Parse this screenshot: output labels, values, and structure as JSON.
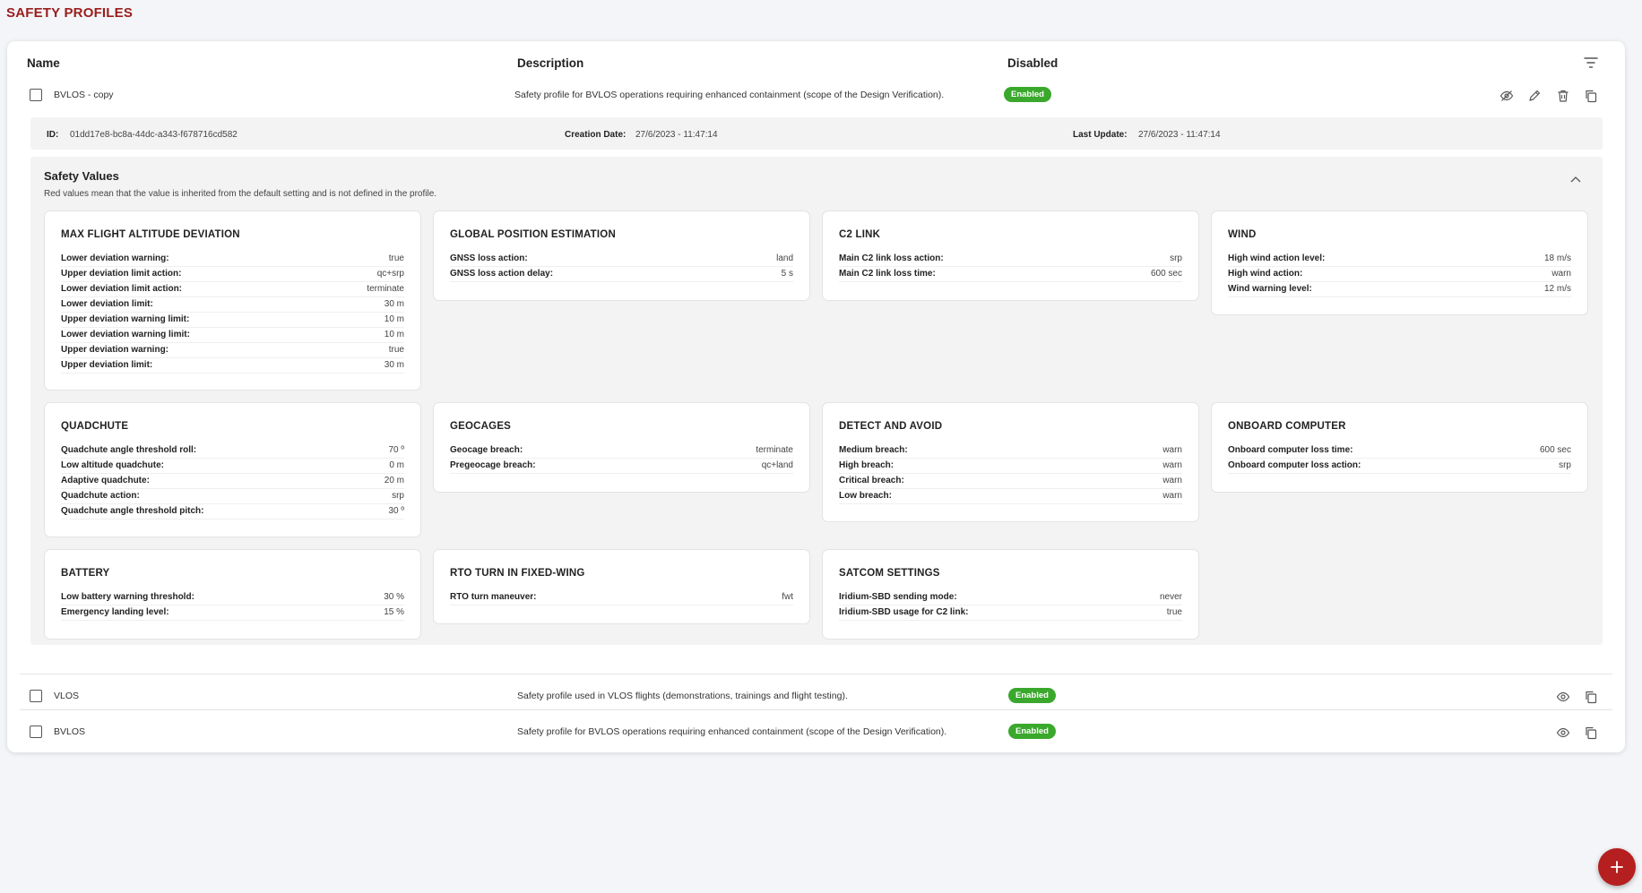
{
  "page": {
    "title": "SAFETY PROFILES"
  },
  "table": {
    "headers": {
      "name": "Name",
      "description": "Description",
      "disabled": "Disabled"
    },
    "rows": [
      {
        "name": "BVLOS - copy",
        "description": "Safety profile for BVLOS operations requiring enhanced containment (scope of the Design Verification).",
        "status": "Enabled"
      },
      {
        "name": "VLOS",
        "description": "Safety profile used in VLOS flights (demonstrations, trainings and flight testing).",
        "status": "Enabled"
      },
      {
        "name": "BVLOS",
        "description": "Safety profile for BVLOS operations requiring enhanced containment (scope of the Design Verification).",
        "status": "Enabled"
      }
    ]
  },
  "details": {
    "id_label": "ID:",
    "id_value": "01dd17e8-bc8a-44dc-a343-f678716cd582",
    "creation_label": "Creation Date:",
    "creation_value": "27/6/2023 - 11:47:14",
    "update_label": "Last Update:",
    "update_value": "27/6/2023 - 11:47:14"
  },
  "safety_values": {
    "title": "Safety Values",
    "subtitle": "Red values mean that the value is inherited from the default setting and is not defined in the profile.",
    "cards": [
      {
        "title": "MAX FLIGHT ALTITUDE DEVIATION",
        "items": [
          {
            "k": "Lower deviation warning:",
            "v": "true"
          },
          {
            "k": "Upper deviation limit action:",
            "v": "qc+srp"
          },
          {
            "k": "Lower deviation limit action:",
            "v": "terminate"
          },
          {
            "k": "Lower deviation limit:",
            "v": "30 m"
          },
          {
            "k": "Upper deviation warning limit:",
            "v": "10 m"
          },
          {
            "k": "Lower deviation warning limit:",
            "v": "10 m"
          },
          {
            "k": "Upper deviation warning:",
            "v": "true"
          },
          {
            "k": "Upper deviation limit:",
            "v": "30 m"
          }
        ]
      },
      {
        "title": "GLOBAL POSITION ESTIMATION",
        "items": [
          {
            "k": "GNSS loss action:",
            "v": "land"
          },
          {
            "k": "GNSS loss action delay:",
            "v": "5 s"
          }
        ]
      },
      {
        "title": "C2 LINK",
        "items": [
          {
            "k": "Main C2 link loss action:",
            "v": "srp"
          },
          {
            "k": "Main C2 link loss time:",
            "v": "600 sec"
          }
        ]
      },
      {
        "title": "WIND",
        "items": [
          {
            "k": "High wind action level:",
            "v": "18 m/s"
          },
          {
            "k": "High wind action:",
            "v": "warn"
          },
          {
            "k": "Wind warning level:",
            "v": "12 m/s"
          }
        ]
      },
      {
        "title": "QUADCHUTE",
        "items": [
          {
            "k": "Quadchute angle threshold roll:",
            "v": "70 º"
          },
          {
            "k": "Low altitude quadchute:",
            "v": "0 m"
          },
          {
            "k": "Adaptive quadchute:",
            "v": "20 m"
          },
          {
            "k": "Quadchute action:",
            "v": "srp"
          },
          {
            "k": "Quadchute angle threshold pitch:",
            "v": "30 º"
          }
        ]
      },
      {
        "title": "GEOCAGES",
        "items": [
          {
            "k": "Geocage breach:",
            "v": "terminate"
          },
          {
            "k": "Pregeocage breach:",
            "v": "qc+land"
          }
        ]
      },
      {
        "title": "DETECT AND AVOID",
        "items": [
          {
            "k": "Medium breach:",
            "v": "warn"
          },
          {
            "k": "High breach:",
            "v": "warn"
          },
          {
            "k": "Critical breach:",
            "v": "warn"
          },
          {
            "k": "Low breach:",
            "v": "warn"
          }
        ]
      },
      {
        "title": "ONBOARD COMPUTER",
        "items": [
          {
            "k": "Onboard computer loss time:",
            "v": "600 sec"
          },
          {
            "k": "Onboard computer loss action:",
            "v": "srp"
          }
        ]
      },
      {
        "title": "BATTERY",
        "items": [
          {
            "k": "Low battery warning threshold:",
            "v": "30 %"
          },
          {
            "k": "Emergency landing level:",
            "v": "15 %"
          }
        ]
      },
      {
        "title": "RTO TURN IN FIXED-WING",
        "items": [
          {
            "k": "RTO turn maneuver:",
            "v": "fwt"
          }
        ]
      },
      {
        "title": "SATCOM SETTINGS",
        "items": [
          {
            "k": "Iridium-SBD sending mode:",
            "v": "never"
          },
          {
            "k": "Iridium-SBD usage for C2 link:",
            "v": "true"
          }
        ]
      }
    ]
  },
  "icons": {
    "filter": "filter-icon",
    "hide": "eye-off-icon",
    "edit": "pencil-icon",
    "delete": "trash-icon",
    "copy": "copy-icon",
    "view": "eye-icon",
    "collapse": "chevron-up-icon",
    "add": "plus-icon"
  },
  "colors": {
    "title": "#9b1c1c",
    "badge": "#3aa82c",
    "fab": "#b51f1f"
  }
}
